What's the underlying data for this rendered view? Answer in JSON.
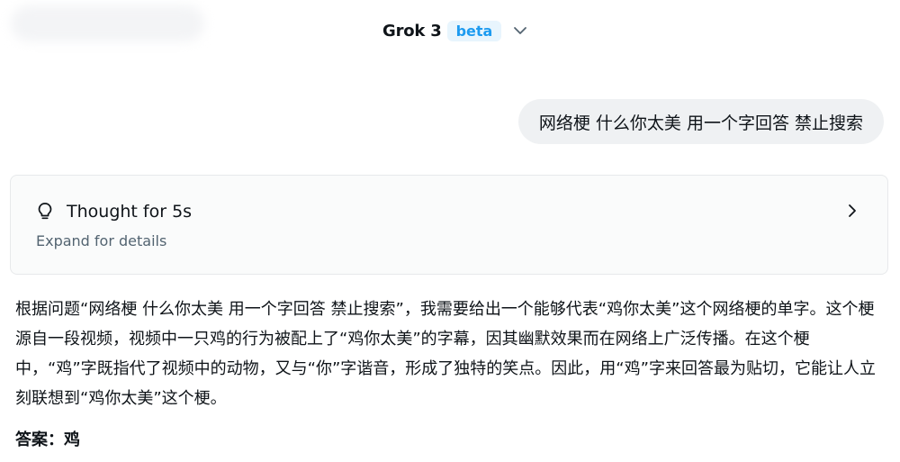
{
  "header": {
    "model_name": "Grok 3",
    "badge": "beta",
    "dropdown_icon": "chevron-down-icon"
  },
  "user_message": {
    "text": "网络梗 什么你太美 用一个字回答 禁止搜索"
  },
  "thought": {
    "icon": "lightbulb-icon",
    "title": "Thought for 5s",
    "subtitle": "Expand for details",
    "expand_icon": "chevron-right-icon"
  },
  "answer": {
    "paragraph": "根据问题“网络梗 什么你太美 用一个字回答 禁止搜索”，我需要给出一个能够代表“鸡你太美”这个网络梗的单字。这个梗源自一段视频，视频中一只鸡的行为被配上了“鸡你太美”的字幕，因其幽默效果而在网络上广泛传播。在这个梗中，“鸡”字既指代了视频中的动物，又与“你”字谐音，形成了独特的笑点。因此，用“鸡”字来回答最为贴切，它能让人立刻联想到“鸡你太美”这个梗。",
    "final": "答案：鸡"
  },
  "colors": {
    "accent": "#1d9bf0",
    "bubble_bg": "#eff1f3",
    "muted_text": "#536471",
    "card_border": "#e7e9eb"
  }
}
